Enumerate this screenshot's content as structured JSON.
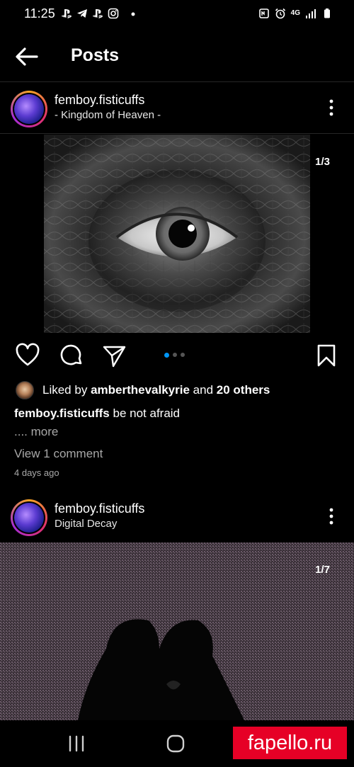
{
  "status_bar": {
    "time": "11:25",
    "left_icons": [
      "playstation-icon",
      "telegram-icon",
      "playstation-icon",
      "instagram-icon",
      "dot-icon"
    ],
    "right_icons": [
      "nfc-icon",
      "alarm-icon",
      "4g-lte-icon",
      "signal-icon",
      "battery-icon"
    ],
    "network_label": "4G"
  },
  "header": {
    "title": "Posts",
    "back_icon": "back-arrow-icon"
  },
  "posts": [
    {
      "username": "femboy.fisticuffs",
      "subtitle": "- Kingdom of Heaven -",
      "counter": "1/3",
      "liked_by_prefix": "Liked by",
      "liked_by_user": "amberthevalkyrie",
      "liked_by_and": "and",
      "liked_by_others": "20 others",
      "caption_user": "femboy.fisticuffs",
      "caption_text": "be not afraid",
      "more_label": ".... more",
      "view_comments": "View 1 comment",
      "time_ago": "4 days ago",
      "carousel_total": 3,
      "carousel_active": 1
    },
    {
      "username": "femboy.fisticuffs",
      "subtitle": "Digital Decay",
      "counter": "1/7"
    }
  ],
  "watermark": {
    "text": "fapello.ru"
  },
  "colors": {
    "accent": "#0095f6",
    "watermark_bg": "#e60026",
    "secondary_text": "#a8a8a8"
  }
}
